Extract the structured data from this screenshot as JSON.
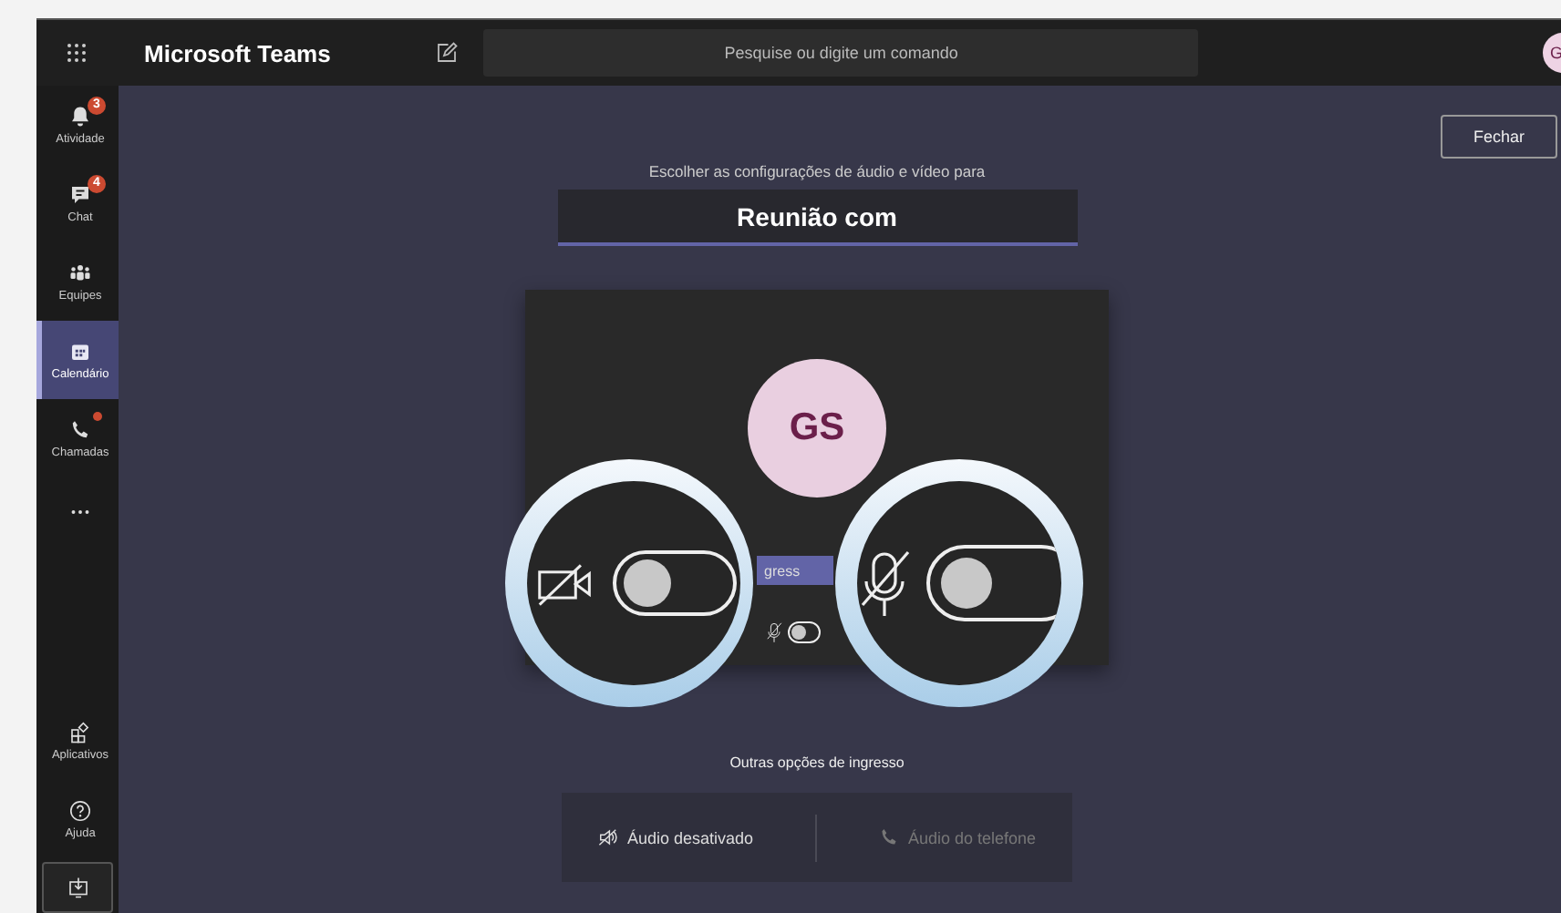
{
  "app": {
    "title": "Microsoft Teams"
  },
  "search": {
    "placeholder": "Pesquise ou digite um comando"
  },
  "profile": {
    "initial": "G"
  },
  "sidebar": {
    "items": [
      {
        "kind": "bell",
        "label": "Atividade",
        "badge": "3",
        "unread_dot": false,
        "selected": false
      },
      {
        "kind": "chat",
        "label": "Chat",
        "badge": "4",
        "unread_dot": false,
        "selected": false
      },
      {
        "kind": "teams",
        "label": "Equipes",
        "unread_dot": false,
        "selected": false
      },
      {
        "kind": "calendar",
        "label": "Calendário",
        "unread_dot": false,
        "selected": true
      },
      {
        "kind": "phone",
        "label": "Chamadas",
        "unread_dot": true,
        "selected": false
      },
      {
        "kind": "more",
        "unread_dot": false,
        "selected": false
      }
    ],
    "bottom_items": [
      {
        "kind": "apps",
        "label": "Aplicativos"
      },
      {
        "kind": "help",
        "label": "Ajuda"
      },
      {
        "kind": "download"
      }
    ]
  },
  "close_button": "Fechar",
  "prompt": "Escolher as configurações de áudio e vídeo para",
  "meeting_title": "Reunião com",
  "preview": {
    "avatar": "GS",
    "join_button": "gress",
    "mic_toggle": {
      "on": false
    }
  },
  "callouts": [
    {
      "kind": "camera",
      "toggle": {
        "on": false
      }
    },
    {
      "kind": "mic",
      "toggle": {
        "on": false
      }
    }
  ],
  "other_options": {
    "title": "Outras opções de ingresso",
    "options": [
      {
        "kind": "audio-off",
        "label": "Áudio desativado",
        "disabled": false
      },
      {
        "kind": "phone",
        "label": "Áudio do telefone",
        "disabled": true
      }
    ]
  }
}
